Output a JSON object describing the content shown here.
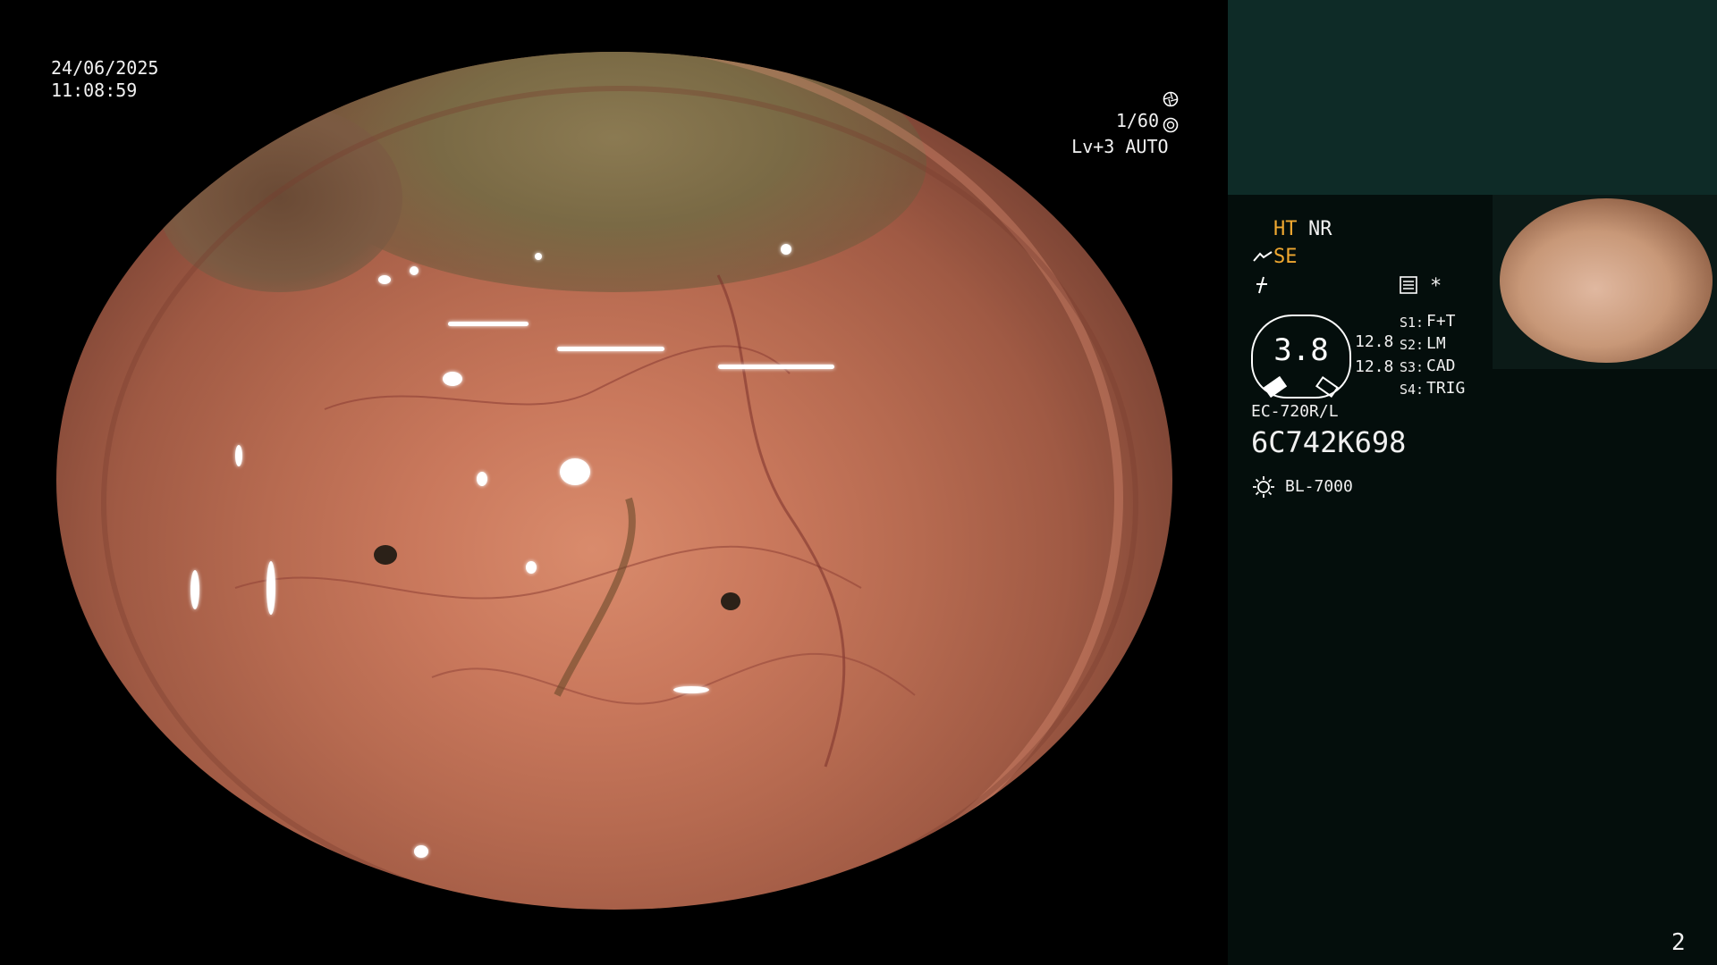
{
  "osd": {
    "date": "24/06/2025",
    "time": "11:08:59",
    "shutter": "1/60",
    "level": "Lv+3 AUTO"
  },
  "panel": {
    "ht": "HT",
    "nr": "NR",
    "se": "SE",
    "asterisk": "*",
    "gauge_value": "3.8",
    "gauge_right_1": "12.8",
    "gauge_right_2": "12.8",
    "switches": [
      {
        "key": "S1:",
        "value": "F+T"
      },
      {
        "key": "S2:",
        "value": "LM"
      },
      {
        "key": "S3:",
        "value": "CAD"
      },
      {
        "key": "S4:",
        "value": "TRIG"
      }
    ],
    "scope_model": "EC-720R/L",
    "serial": "6C742K698",
    "light_source": "BL-7000",
    "page_number": "2"
  },
  "colors": {
    "panel_top": "#0e2b27",
    "panel_bg": "#040e0c",
    "accent": "#f0a830"
  },
  "icons": [
    "shutter-icon",
    "auto-iris-icon",
    "scope-tip-icon",
    "frequency-icon",
    "settings-list-icon",
    "light-source-icon"
  ]
}
